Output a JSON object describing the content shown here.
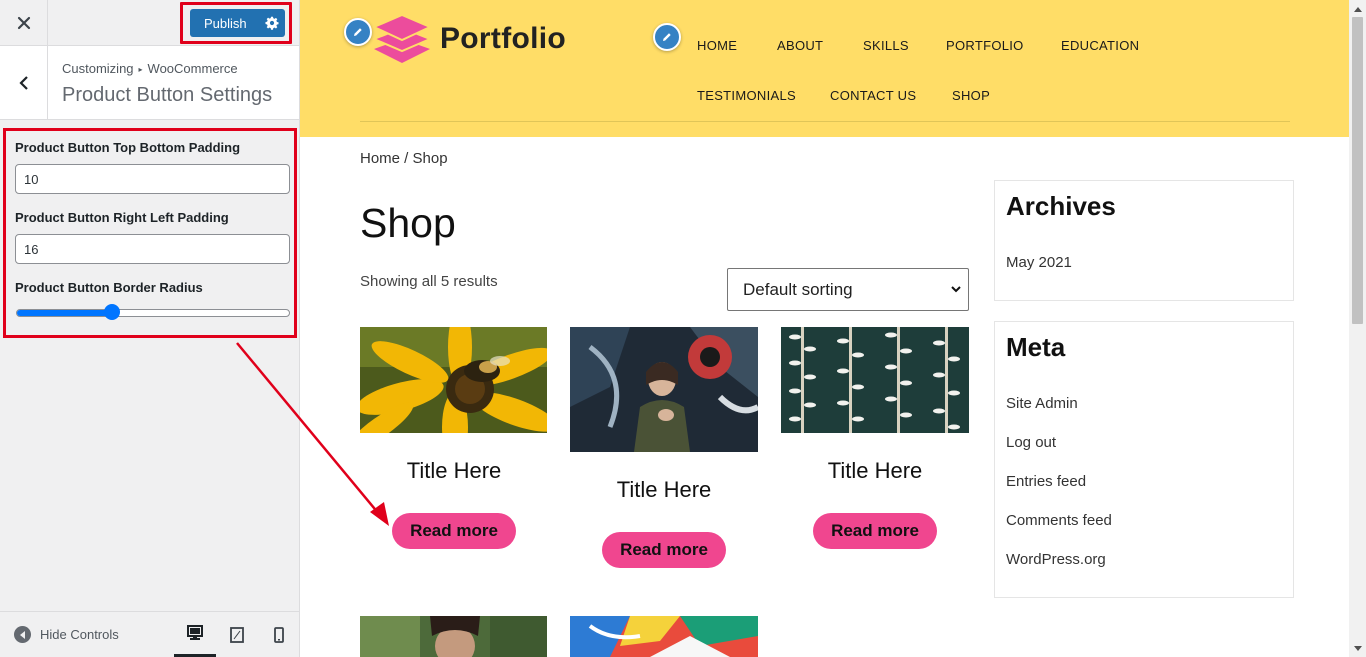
{
  "sidebar": {
    "publish_label": "Publish",
    "breadcrumb_root": "Customizing",
    "breadcrumb_parent": "WooCommerce",
    "section_title": "Product Button Settings",
    "controls": {
      "top_bottom_label": "Product Button Top Bottom Padding",
      "top_bottom_value": "10",
      "right_left_label": "Product Button Right Left Padding",
      "right_left_value": "16",
      "radius_label": "Product Button Border Radius",
      "radius_fraction": 0.35
    },
    "footer": {
      "hide_controls_label": "Hide Controls",
      "active_device": "desktop"
    }
  },
  "preview": {
    "logo_text": "Portfolio",
    "nav": {
      "home": "HOME",
      "about": "ABOUT",
      "skills": "SKILLS",
      "portfolio": "PORTFOLIO",
      "education": "EDUCATION",
      "testimonials": "TESTIMONIALS",
      "contact": "CONTACT US",
      "shop": "SHOP"
    },
    "breadcrumb": "Home / Shop",
    "page_title": "Shop",
    "result_count": "Showing all 5 results",
    "sort_selected": "Default sorting",
    "products": [
      {
        "title": "Title Here",
        "button": "Read more",
        "image": "yellow-flower-bee"
      },
      {
        "title": "Title Here",
        "button": "Read more",
        "image": "woman-graffiti-wall"
      },
      {
        "title": "Title Here",
        "button": "Read more",
        "image": "aerial-marina-boats"
      },
      {
        "image": "woman-portrait-green"
      },
      {
        "image": "colorful-paint-abstract"
      }
    ],
    "archives": {
      "title": "Archives",
      "items": [
        "May 2021"
      ]
    },
    "meta": {
      "title": "Meta",
      "items": [
        "Site Admin",
        "Log out",
        "Entries feed",
        "Comments feed",
        "WordPress.org"
      ]
    }
  },
  "colors": {
    "accent_red": "#e0001b",
    "publish_blue": "#2271b1",
    "header_yellow": "#ffdd67",
    "button_pink": "#f0468f",
    "logo_pink": "#ec4c9c"
  }
}
